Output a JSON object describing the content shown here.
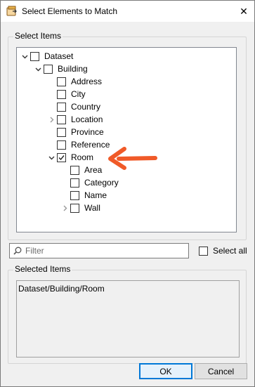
{
  "window": {
    "title": "Select Elements to Match",
    "close_glyph": "✕"
  },
  "select_items": {
    "group_label": "Select Items",
    "tree": [
      {
        "label": "Dataset",
        "expander": "expanded",
        "checked": false
      },
      {
        "label": "Building",
        "expander": "expanded",
        "checked": false
      },
      {
        "label": "Address",
        "expander": "none",
        "checked": false
      },
      {
        "label": "City",
        "expander": "none",
        "checked": false
      },
      {
        "label": "Country",
        "expander": "none",
        "checked": false
      },
      {
        "label": "Location",
        "expander": "collapsed",
        "checked": false
      },
      {
        "label": "Province",
        "expander": "none",
        "checked": false
      },
      {
        "label": "Reference",
        "expander": "none",
        "checked": false
      },
      {
        "label": "Room",
        "expander": "expanded",
        "checked": true
      },
      {
        "label": "Area",
        "expander": "none",
        "checked": false
      },
      {
        "label": "Category",
        "expander": "none",
        "checked": false
      },
      {
        "label": "Name",
        "expander": "none",
        "checked": false
      },
      {
        "label": "Wall",
        "expander": "collapsed",
        "checked": false
      }
    ]
  },
  "annotation": {
    "arrow_color": "#f05a28"
  },
  "filter": {
    "placeholder": "Filter",
    "value": ""
  },
  "select_all": {
    "label": "Select all",
    "checked": false
  },
  "selected_items": {
    "group_label": "Selected Items",
    "text": "Dataset/Building/Room"
  },
  "buttons": {
    "ok_label": "OK",
    "cancel_label": "Cancel"
  },
  "colors": {
    "accent": "#0078d7"
  }
}
